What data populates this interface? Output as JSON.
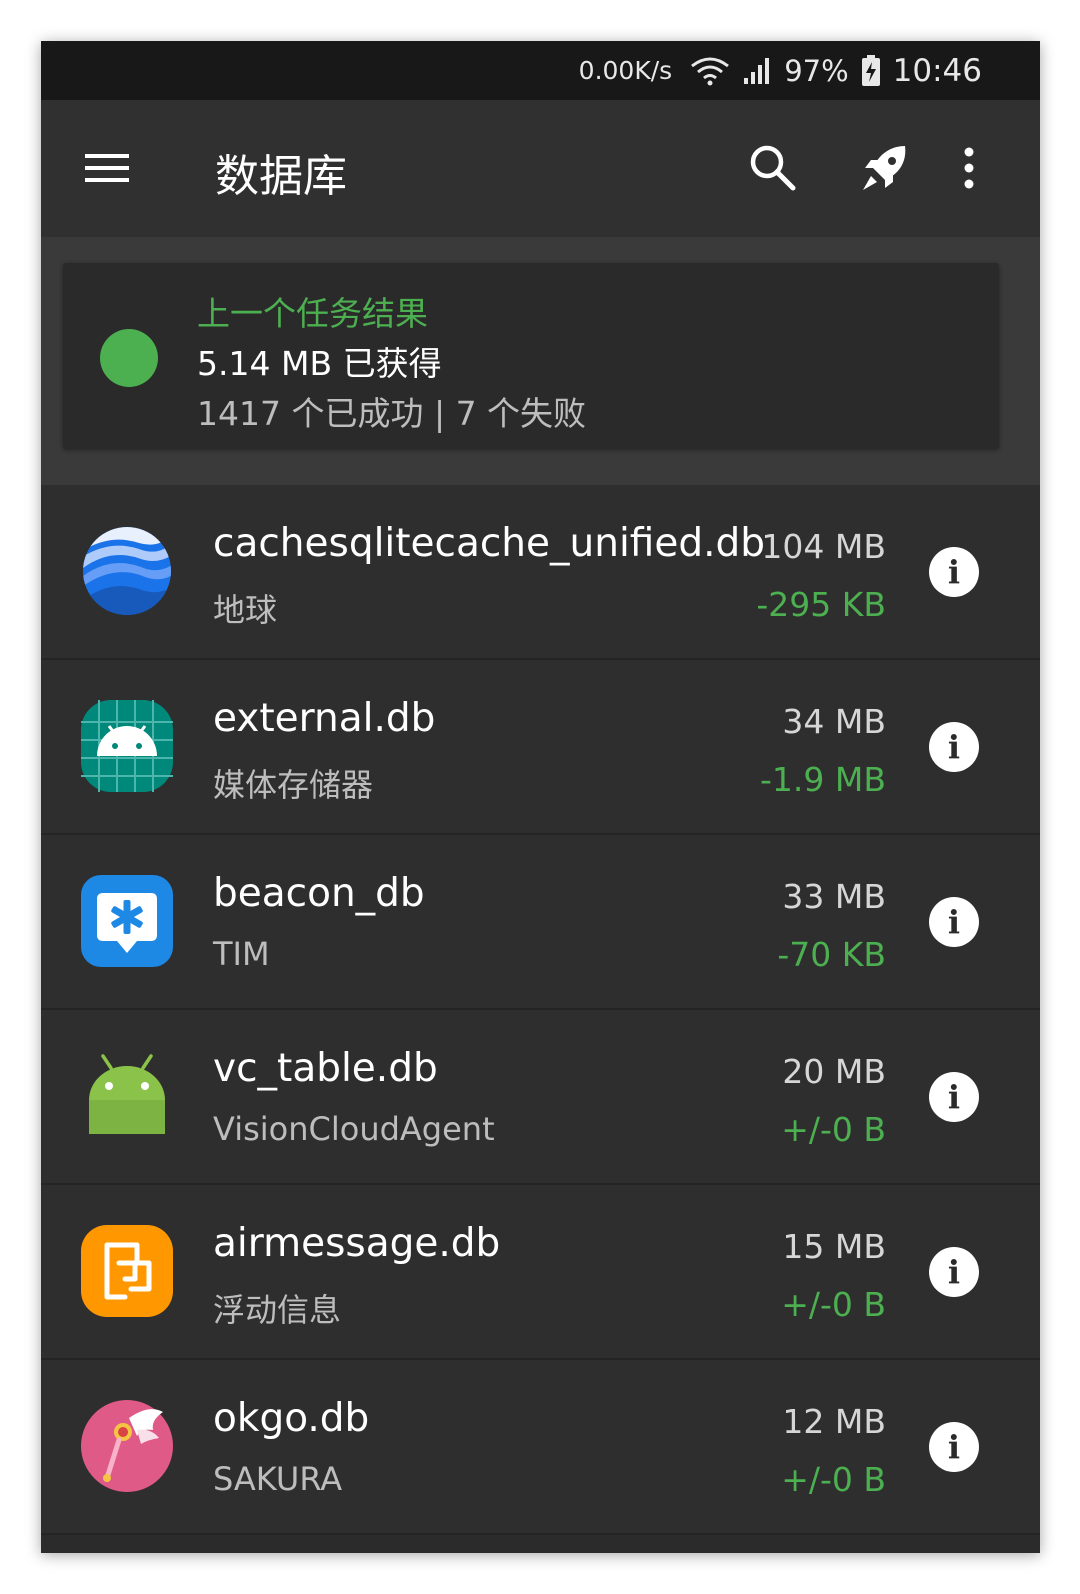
{
  "status_bar": {
    "network_speed": "0.00K/s",
    "battery": "97%",
    "time": "10:46"
  },
  "app_bar": {
    "title": "数据库",
    "icons": [
      "menu-icon",
      "search-icon",
      "rocket-icon",
      "more-vert-icon"
    ]
  },
  "summary": {
    "title": "上一个任务结果",
    "size": "5.14 MB 已获得",
    "counts": "1417 个已成功 | 7 个失败",
    "status_color": "#4caf50"
  },
  "databases": [
    {
      "name": "cachesqlitecache_unified.db",
      "app": "地球",
      "size": "104 MB",
      "delta": "-295 KB",
      "icon": "google-earth-icon"
    },
    {
      "name": "external.db",
      "app": "媒体存储器",
      "size": "34 MB",
      "delta": "-1.9 MB",
      "icon": "android-media-icon"
    },
    {
      "name": "beacon_db",
      "app": "TIM",
      "size": "33 MB",
      "delta": "-70 KB",
      "icon": "tim-icon"
    },
    {
      "name": "vc_table.db",
      "app": "VisionCloudAgent",
      "size": "20 MB",
      "delta": "+/-0 B",
      "icon": "android-robot-icon"
    },
    {
      "name": "airmessage.db",
      "app": "浮动信息",
      "size": "15 MB",
      "delta": "+/-0 B",
      "icon": "airmessage-icon"
    },
    {
      "name": "okgo.db",
      "app": "SAKURA",
      "size": "12 MB",
      "delta": "+/-0 B",
      "icon": "sakura-wand-icon"
    }
  ],
  "colors": {
    "accent_green": "#4caf50",
    "background": "#2e2e2e",
    "toolbar": "#303030"
  }
}
